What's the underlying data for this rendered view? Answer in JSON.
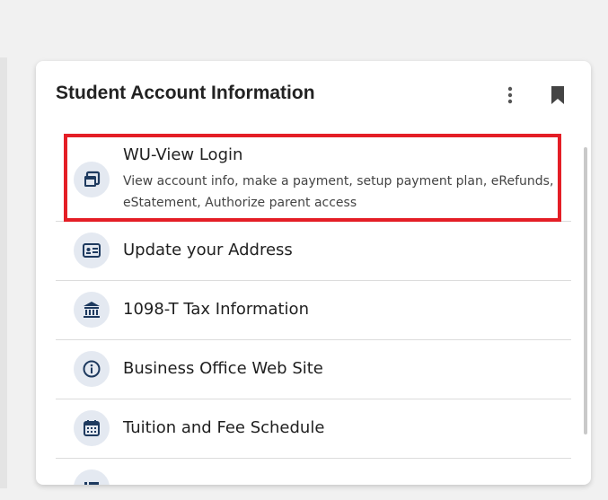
{
  "card": {
    "title": "Student Account Information",
    "menu_icon": "more-vert-icon",
    "bookmark_icon": "bookmark-icon"
  },
  "items": [
    {
      "title": "WU-View Login",
      "description": "View account info, make a payment, setup payment plan, eRefunds, eStatement, Authorize parent access",
      "icon": "open-in-window-icon",
      "highlighted": true
    },
    {
      "title": "Update your Address",
      "icon": "id-card-icon"
    },
    {
      "title": "1098-T Tax Information",
      "icon": "bank-icon"
    },
    {
      "title": "Business Office Web Site",
      "icon": "info-icon"
    },
    {
      "title": "Tuition and Fee Schedule",
      "icon": "calendar-icon"
    },
    {
      "title": "",
      "icon": "list-icon"
    }
  ],
  "colors": {
    "highlight": "#e41e26",
    "icon_bg": "#e4e9f1",
    "icon_fg": "#1e3a5f"
  }
}
